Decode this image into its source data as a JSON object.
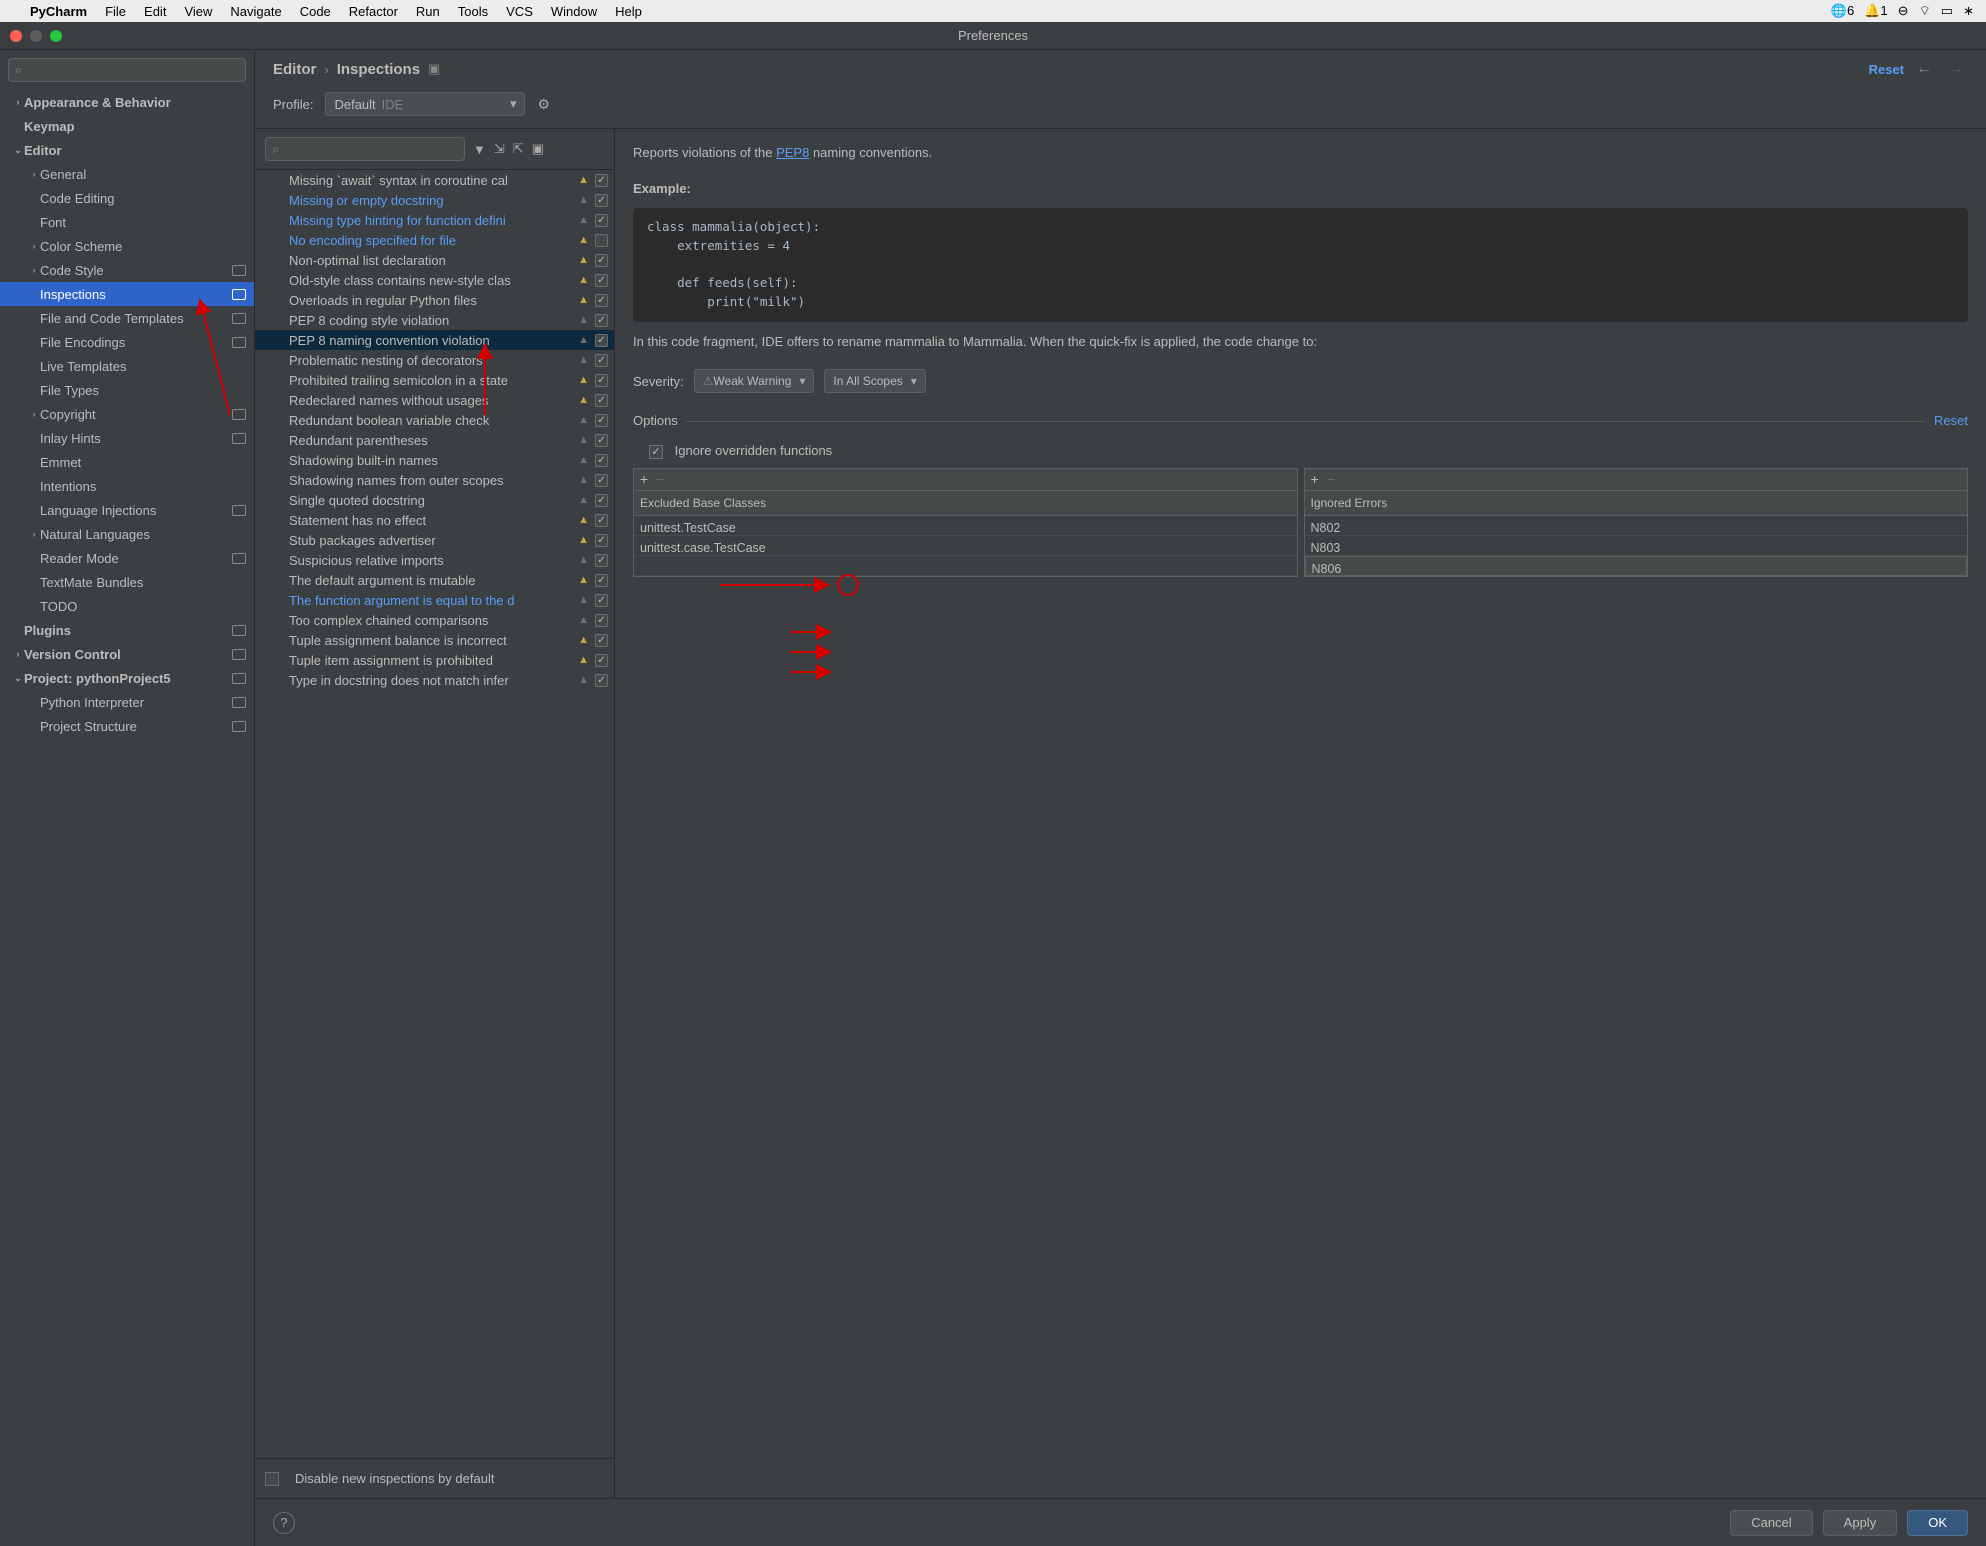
{
  "menubar": {
    "app": "PyCharm",
    "items": [
      "File",
      "Edit",
      "View",
      "Navigate",
      "Code",
      "Refactor",
      "Run",
      "Tools",
      "VCS",
      "Window",
      "Help"
    ],
    "sys_counter1": "6",
    "sys_counter2": "1"
  },
  "window_title": "Preferences",
  "breadcrumb": {
    "item1": "Editor",
    "item2": "Inspections",
    "reset": "Reset"
  },
  "profile": {
    "label": "Profile:",
    "value": "Default",
    "tag": "IDE"
  },
  "sidebar": {
    "items": [
      {
        "label": "Appearance & Behavior",
        "indent": 0,
        "arrow": ">",
        "bold": true
      },
      {
        "label": "Keymap",
        "indent": 0,
        "arrow": "",
        "bold": true
      },
      {
        "label": "Editor",
        "indent": 0,
        "arrow": "v",
        "bold": true
      },
      {
        "label": "General",
        "indent": 1,
        "arrow": ">"
      },
      {
        "label": "Code Editing",
        "indent": 1,
        "arrow": ""
      },
      {
        "label": "Font",
        "indent": 1,
        "arrow": ""
      },
      {
        "label": "Color Scheme",
        "indent": 1,
        "arrow": ">"
      },
      {
        "label": "Code Style",
        "indent": 1,
        "arrow": ">",
        "badge": true
      },
      {
        "label": "Inspections",
        "indent": 1,
        "arrow": "",
        "selected": true,
        "badge": true
      },
      {
        "label": "File and Code Templates",
        "indent": 1,
        "arrow": "",
        "badge": true
      },
      {
        "label": "File Encodings",
        "indent": 1,
        "arrow": "",
        "badge": true
      },
      {
        "label": "Live Templates",
        "indent": 1,
        "arrow": ""
      },
      {
        "label": "File Types",
        "indent": 1,
        "arrow": ""
      },
      {
        "label": "Copyright",
        "indent": 1,
        "arrow": ">",
        "badge": true
      },
      {
        "label": "Inlay Hints",
        "indent": 1,
        "arrow": "",
        "badge": true
      },
      {
        "label": "Emmet",
        "indent": 1,
        "arrow": ""
      },
      {
        "label": "Intentions",
        "indent": 1,
        "arrow": ""
      },
      {
        "label": "Language Injections",
        "indent": 1,
        "arrow": "",
        "badge": true
      },
      {
        "label": "Natural Languages",
        "indent": 1,
        "arrow": ">"
      },
      {
        "label": "Reader Mode",
        "indent": 1,
        "arrow": "",
        "badge": true
      },
      {
        "label": "TextMate Bundles",
        "indent": 1,
        "arrow": ""
      },
      {
        "label": "TODO",
        "indent": 1,
        "arrow": ""
      },
      {
        "label": "Plugins",
        "indent": 0,
        "arrow": "",
        "bold": true,
        "badge": true
      },
      {
        "label": "Version Control",
        "indent": 0,
        "arrow": ">",
        "bold": true,
        "badge": true
      },
      {
        "label": "Project: pythonProject5",
        "indent": 0,
        "arrow": "v",
        "bold": true,
        "badge": true
      },
      {
        "label": "Python Interpreter",
        "indent": 1,
        "arrow": "",
        "badge": true
      },
      {
        "label": "Project Structure",
        "indent": 1,
        "arrow": "",
        "badge": true
      }
    ]
  },
  "inspections": [
    {
      "name": "Missing `await` syntax in coroutine cal",
      "warn": "orange",
      "checked": true
    },
    {
      "name": "Missing or empty docstring",
      "warn": "gray",
      "checked": true,
      "modified": true
    },
    {
      "name": "Missing type hinting for function defini",
      "warn": "gray",
      "checked": true,
      "modified": true
    },
    {
      "name": "No encoding specified for file",
      "warn": "orange",
      "checked": false,
      "modified": true
    },
    {
      "name": "Non-optimal list declaration",
      "warn": "orange",
      "checked": true
    },
    {
      "name": "Old-style class contains new-style clas",
      "warn": "orange",
      "checked": true
    },
    {
      "name": "Overloads in regular Python files",
      "warn": "orange",
      "checked": true
    },
    {
      "name": "PEP 8 coding style violation",
      "warn": "gray",
      "checked": true
    },
    {
      "name": "PEP 8 naming convention violation",
      "warn": "gray",
      "checked": true,
      "selected": true
    },
    {
      "name": "Problematic nesting of decorators",
      "warn": "gray",
      "checked": true
    },
    {
      "name": "Prohibited trailing semicolon in a state",
      "warn": "orange",
      "checked": true
    },
    {
      "name": "Redeclared names without usages",
      "warn": "orange",
      "checked": true
    },
    {
      "name": "Redundant boolean variable check",
      "warn": "gray",
      "checked": true
    },
    {
      "name": "Redundant parentheses",
      "warn": "gray",
      "checked": true
    },
    {
      "name": "Shadowing built-in names",
      "warn": "gray",
      "checked": true
    },
    {
      "name": "Shadowing names from outer scopes",
      "warn": "gray",
      "checked": true
    },
    {
      "name": "Single quoted docstring",
      "warn": "gray",
      "checked": true
    },
    {
      "name": "Statement has no effect",
      "warn": "orange",
      "checked": true
    },
    {
      "name": "Stub packages advertiser",
      "warn": "orange",
      "checked": true
    },
    {
      "name": "Suspicious relative imports",
      "warn": "gray",
      "checked": true
    },
    {
      "name": "The default argument is mutable",
      "warn": "orange",
      "checked": true
    },
    {
      "name": "The function argument is equal to the d",
      "warn": "gray",
      "checked": true,
      "modified": true
    },
    {
      "name": "Too complex chained comparisons",
      "warn": "gray",
      "checked": true
    },
    {
      "name": "Tuple assignment balance is incorrect",
      "warn": "orange",
      "checked": true
    },
    {
      "name": "Tuple item assignment is prohibited",
      "warn": "orange",
      "checked": true
    },
    {
      "name": "Type in docstring does not match infer",
      "warn": "gray",
      "checked": true
    }
  ],
  "disable_new": "Disable new inspections by default",
  "description": {
    "intro1": "Reports violations of the ",
    "link": "PEP8",
    "intro2": " naming conventions.",
    "example_label": "Example:",
    "code": "class mammalia(object):\n    extremities = 4\n\n    def feeds(self):\n        print(\"milk\")",
    "after": "In this code fragment, IDE offers to rename mammalia to Mammalia. When the quick-fix is applied, the code change to:"
  },
  "severity": {
    "label": "Severity:",
    "value": "Weak Warning",
    "scope": "In All Scopes"
  },
  "options": {
    "label": "Options",
    "reset": "Reset",
    "ignore_overridden": "Ignore overridden functions",
    "excluded_header": "Excluded Base Classes",
    "ignored_header": "Ignored Errors",
    "excluded": [
      "unittest.TestCase",
      "unittest.case.TestCase"
    ],
    "ignored": [
      "N802",
      "N803",
      "N806"
    ]
  },
  "footer": {
    "cancel": "Cancel",
    "apply": "Apply",
    "ok": "OK"
  }
}
